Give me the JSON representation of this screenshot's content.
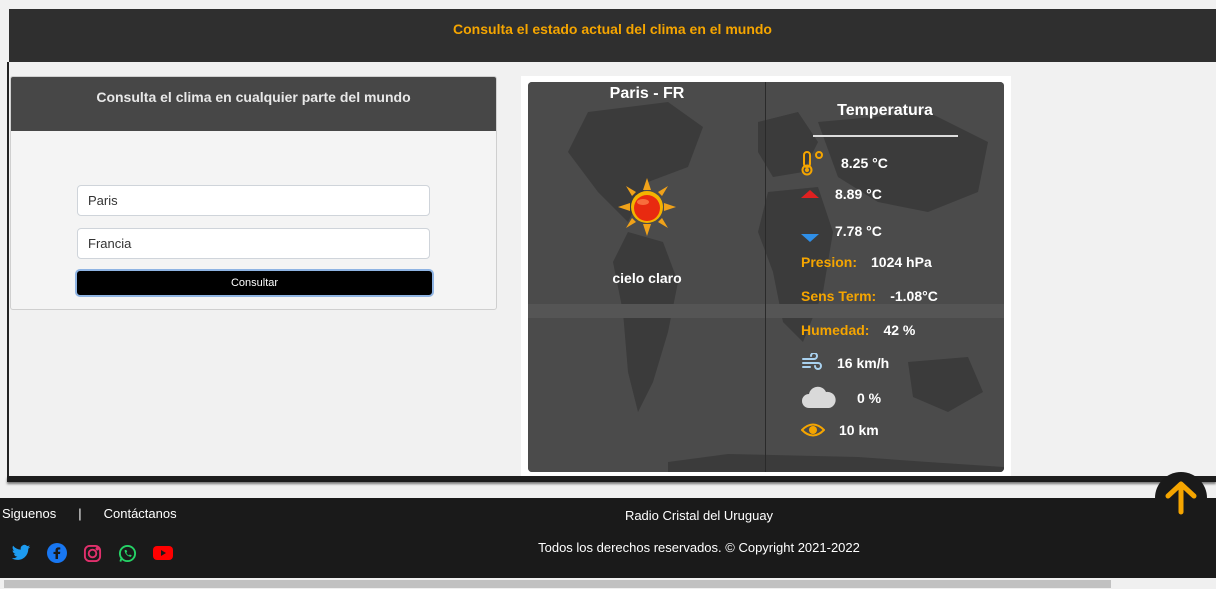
{
  "header": {
    "title": "Consulta el estado actual del clima en el mundo"
  },
  "form": {
    "title": "Consulta el clima en cualquier parte del mundo",
    "city_value": "Paris",
    "country_value": "Francia",
    "submit_label": "Consultar"
  },
  "weather": {
    "location": "Paris - FR",
    "description": "cielo claro",
    "section_title": "Temperatura",
    "temp": "8.25 °C",
    "temp_max": "8.89 °C",
    "temp_min": "7.78 °C",
    "pressure_label": "Presion:",
    "pressure_value": "1024 hPa",
    "feels_label": "Sens Term:",
    "feels_value": "-1.08°C",
    "humidity_label": "Humedad:",
    "humidity_value": "42 %",
    "wind": "16 km/h",
    "clouds": "0 %",
    "visibility": "10 km",
    "icons": {
      "temp": "thermometer-icon",
      "max": "arrow-up-icon",
      "min": "arrow-down-icon",
      "wind": "wind-icon",
      "clouds": "cloud-icon",
      "visibility": "eye-icon",
      "condition": "sun-icon"
    },
    "colors": {
      "accent": "#f5a500",
      "max_arrow": "#e02020",
      "min_arrow": "#2f8fe8"
    }
  },
  "footer": {
    "follow_label": "Siguenos",
    "separator": "|",
    "contact_label": "Contáctanos",
    "brand": "Radio Cristal del Uruguay",
    "copyright": "Todos los derechos reservados. © Copyright 2021-2022",
    "social": [
      "twitter-icon",
      "facebook-icon",
      "instagram-icon",
      "whatsapp-icon",
      "youtube-icon"
    ]
  }
}
